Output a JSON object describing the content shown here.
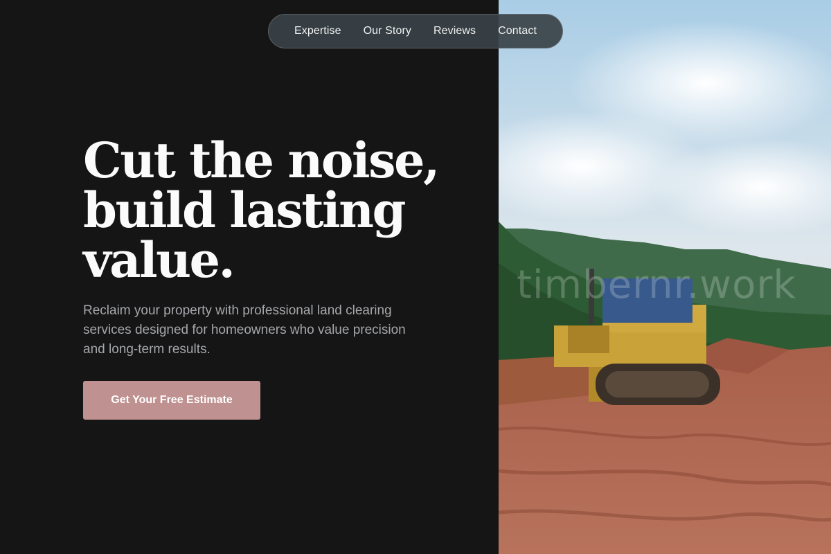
{
  "nav": {
    "items": [
      {
        "label": "Expertise"
      },
      {
        "label": "Our Story"
      },
      {
        "label": "Reviews"
      },
      {
        "label": "Contact"
      }
    ]
  },
  "hero": {
    "headline": "Cut the noise, build lasting value.",
    "subtext": "Reclaim your property with professional land clearing services designed for homeowners who value precision and long-term results.",
    "cta_label": "Get Your Free Estimate"
  },
  "photo": {
    "watermark": "timbernr.work",
    "subject": "bulldozer clearing red dirt land with forested hills behind"
  },
  "colors": {
    "background": "#151515",
    "accent": "#bf9190",
    "headline": "#fbfbfb",
    "subtext": "#a5a7ab",
    "nav_bg": "#3a4248"
  }
}
